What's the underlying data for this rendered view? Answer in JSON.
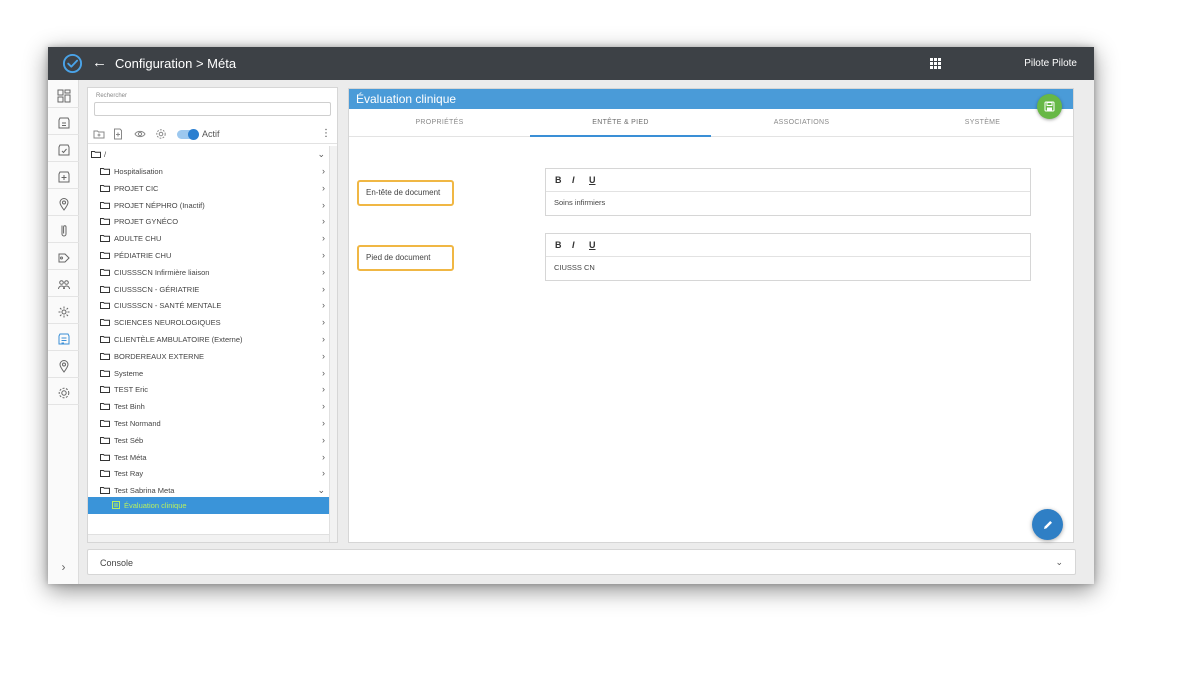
{
  "topbar": {
    "back_icon": "←",
    "title": "Configuration > Méta",
    "user": "Pilote Pilote"
  },
  "rail": {
    "items": [
      "dashboard-icon",
      "forms-icon",
      "validation-icon",
      "process-icon",
      "location-icon",
      "document-icon",
      "tag-icon",
      "users-icon",
      "modules-icon",
      "meta-icon",
      "map-pin-icon",
      "settings-icon"
    ],
    "active_index": 9,
    "expand_icon": "›"
  },
  "tree": {
    "search_label": "Rechercher",
    "search_value": "",
    "toggle_on": true,
    "toggle_label": "Actif",
    "menu_icon": "⋮",
    "root_label": "/",
    "nodes": [
      {
        "label": "Hospitalisation"
      },
      {
        "label": "PROJET CIC"
      },
      {
        "label": "PROJET NÉPHRO (Inactif)"
      },
      {
        "label": "PROJET GYNÉCO"
      },
      {
        "label": "ADULTE CHU"
      },
      {
        "label": "PÉDIATRIE CHU"
      },
      {
        "label": "CIUSSSCN Infirmière liaison"
      },
      {
        "label": "CIUSSSCN - GÉRIATRIE"
      },
      {
        "label": "CIUSSSCN - SANTÉ MENTALE"
      },
      {
        "label": "SCIENCES NEUROLOGIQUES"
      },
      {
        "label": "CLIENTÈLE AMBULATOIRE (Externe)"
      },
      {
        "label": "BORDEREAUX EXTERNE"
      },
      {
        "label": "Systeme"
      },
      {
        "label": "TEST Eric"
      },
      {
        "label": "Test Binh"
      },
      {
        "label": "Test Normand"
      },
      {
        "label": "Test Séb"
      },
      {
        "label": "Test Méta"
      },
      {
        "label": "Test Ray"
      },
      {
        "label": "Test Sabrina Meta"
      }
    ],
    "selected_child": "Évaluation clinique"
  },
  "editor": {
    "title": "Évaluation clinique",
    "tabs": [
      "PROPRIÉTÉS",
      "ENTÊTE & PIED",
      "ASSOCIATIONS",
      "SYSTÈME"
    ],
    "active_tab": 1,
    "header_label": "En-tête de document",
    "header_value": "Soins infirmiers",
    "footer_label": "Pied de document",
    "footer_value": "CIUSSS CN",
    "format_bold": "B",
    "format_italic": "I",
    "format_underline": "U"
  },
  "console": {
    "label": "Console"
  },
  "colors": {
    "topbar": "#3d4146",
    "accent": "#3a8fd6",
    "header": "#4a9bd8",
    "save": "#67b846",
    "highlight": "#f0b744"
  }
}
